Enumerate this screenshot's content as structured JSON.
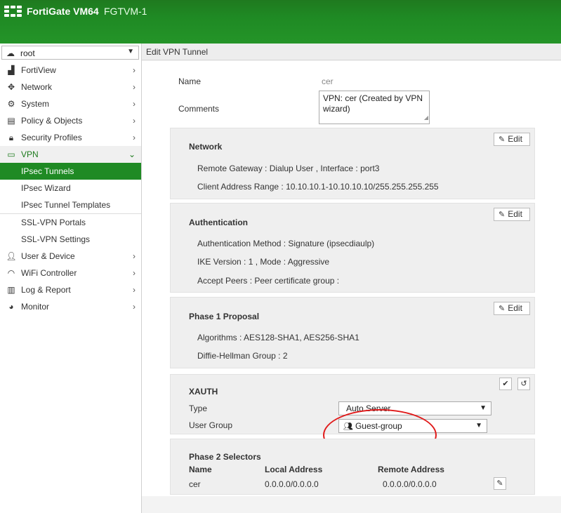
{
  "header": {
    "brand": "FortiGate VM64",
    "hostname": "FGTVM-1"
  },
  "sidebar": {
    "vdom": "root",
    "items": [
      {
        "label": "FortiView",
        "icon": "chart-icon"
      },
      {
        "label": "Network",
        "icon": "network-icon"
      },
      {
        "label": "System",
        "icon": "gear-icon"
      },
      {
        "label": "Policy & Objects",
        "icon": "policy-icon"
      },
      {
        "label": "Security Profiles",
        "icon": "lock-icon"
      },
      {
        "label": "VPN",
        "icon": "laptop-icon",
        "expanded": true
      },
      {
        "label": "IPsec Tunnels",
        "active": true
      },
      {
        "label": "IPsec Wizard"
      },
      {
        "label": "IPsec Tunnel Templates"
      },
      {
        "label": "SSL-VPN Portals"
      },
      {
        "label": "SSL-VPN Settings"
      },
      {
        "label": "User & Device",
        "icon": "user-icon"
      },
      {
        "label": "WiFi Controller",
        "icon": "wifi-icon"
      },
      {
        "label": "Log & Report",
        "icon": "report-icon"
      },
      {
        "label": "Monitor",
        "icon": "pie-icon"
      }
    ]
  },
  "page": {
    "title": "Edit VPN Tunnel"
  },
  "form": {
    "name_label": "Name",
    "name_value": "cer",
    "comments_label": "Comments",
    "comments_value": "VPN: cer (Created by VPN wizard)"
  },
  "network": {
    "title": "Network",
    "edit_label": "Edit",
    "remote_gateway": "Remote Gateway : Dialup User , Interface : port3",
    "client_range": "Client Address Range : 10.10.10.1-10.10.10.10/255.255.255.255"
  },
  "auth": {
    "title": "Authentication",
    "edit_label": "Edit",
    "method": "Authentication Method : Signature (ipsecdiaulp)",
    "ike": "IKE Version : 1 , Mode : Aggressive",
    "peers": "Accept Peers : Peer certificate group :"
  },
  "phase1": {
    "title": "Phase 1 Proposal",
    "edit_label": "Edit",
    "algorithms": "Algorithms : AES128-SHA1, AES256-SHA1",
    "dh": "Diffie-Hellman Group : 2"
  },
  "xauth": {
    "title": "XAUTH",
    "type_label": "Type",
    "type_value": "Auto Server",
    "group_label": "User Group",
    "group_value": "Guest-group"
  },
  "phase2": {
    "title": "Phase 2 Selectors",
    "columns": [
      "Name",
      "Local Address",
      "Remote Address"
    ],
    "rows": [
      {
        "name": "cer",
        "local": "0.0.0.0/0.0.0.0",
        "remote": "0.0.0.0/0.0.0.0"
      }
    ]
  },
  "colors": {
    "brand_green": "#1f8a24",
    "annotation_red": "#e01a1a"
  }
}
